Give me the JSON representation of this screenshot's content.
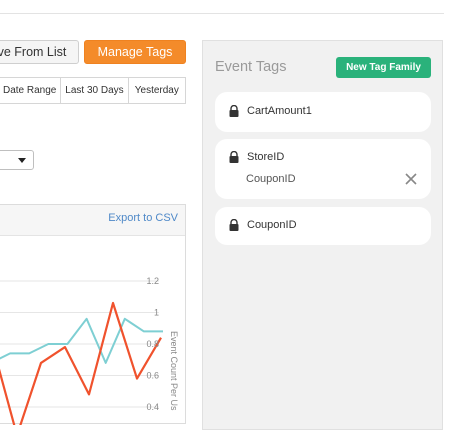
{
  "toolbar": {
    "remove_label": "ove From List",
    "manage_label": "Manage Tags"
  },
  "date_range": {
    "options": [
      "Date Range",
      "Last 30 Days",
      "Yesterday"
    ]
  },
  "chart_panel": {
    "export_label": "Export to CSV"
  },
  "chart_data": {
    "type": "line",
    "ylabel": "Event Count Per Us",
    "y_ticks": [
      "1.2",
      "1",
      "0.8",
      "0.6",
      "0.4"
    ],
    "ylim": [
      0.4,
      1.2
    ],
    "series": [
      {
        "color": "#7ecfd3",
        "values": [
          0.68,
          0.74,
          0.74,
          0.8,
          0.8,
          0.96,
          0.68,
          0.96,
          0.88,
          0.88
        ]
      },
      {
        "color": "#f0522d",
        "values": [
          0.78,
          0.22,
          0.68,
          0.78,
          0.48,
          1.06,
          0.58,
          0.84
        ]
      }
    ]
  },
  "event_tags": {
    "title": "Event Tags",
    "new_family_label": "New Tag Family",
    "cards": [
      {
        "name": "CartAmount1"
      },
      {
        "name": "StoreID",
        "child": "CouponID"
      },
      {
        "name": "CouponID"
      }
    ],
    "colors": {
      "accent_green": "#2ab27b",
      "accent_orange": "#f48b2a"
    },
    "icons": {
      "lock": "lock-icon",
      "remove": "close-icon"
    }
  }
}
